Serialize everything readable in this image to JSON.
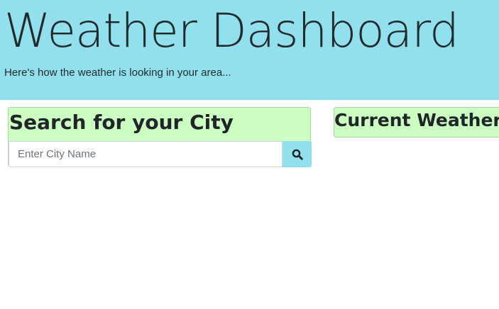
{
  "header": {
    "title": "Weather Dashboard",
    "lead": "Here's how the weather is looking in your area..."
  },
  "search": {
    "heading": "Search for your City",
    "placeholder": "Enter City Name",
    "value": "",
    "button_icon": "search-icon"
  },
  "current_weather": {
    "heading": "Current Weather:"
  },
  "colors": {
    "header_bg": "#92dfee",
    "card_bg": "#ccffc2",
    "button_bg": "#92dfee"
  }
}
